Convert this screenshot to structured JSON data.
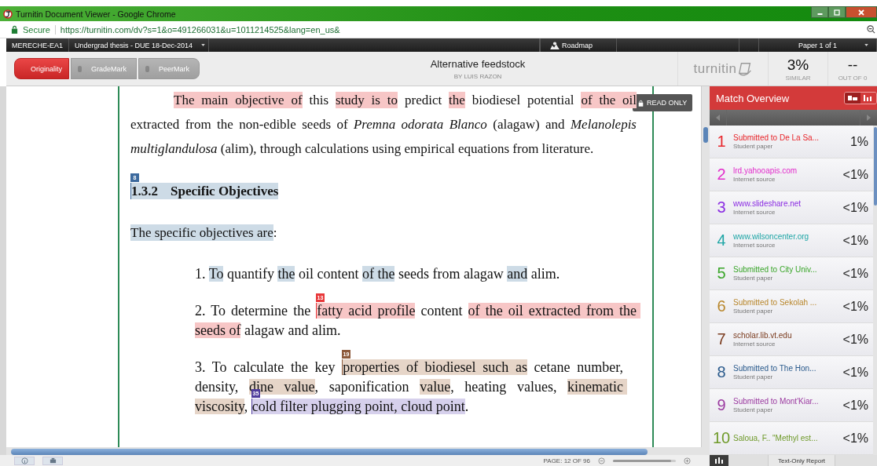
{
  "window": {
    "title": "Turnitin Document Viewer - Google Chrome"
  },
  "address_bar": {
    "secure_label": "Secure",
    "url": "https://turnitin.com/dv?s=1&o=491266031&u=1011214525&lang=en_us&"
  },
  "nav_bar": {
    "class_name": "MERECHE-EA1",
    "assignment": "Undergrad thesis - DUE 18-Dec-2014",
    "roadmap": "Roadmap",
    "paper": "Paper 1 of 1"
  },
  "tabs": [
    {
      "label": "Originality",
      "selected": true
    },
    {
      "label": "GradeMark",
      "selected": false
    },
    {
      "label": "PeerMark",
      "selected": false
    }
  ],
  "document": {
    "title": "Alternative feedstock",
    "author": "BY LUIS RAZON",
    "read_only": "READ ONLY"
  },
  "brand": "turnitin",
  "scores": [
    {
      "value": "3%",
      "label": "SIMILAR"
    },
    {
      "value": "--",
      "label": "OUT OF 0"
    }
  ],
  "blocks": [
    {
      "kind": "paragraph",
      "segments": [
        {
          "t": "The main objective of",
          "color": "#f7c6c6"
        },
        {
          "t": " this "
        },
        {
          "t": "study is to",
          "color": "#f7c6c6"
        },
        {
          "t": " predict "
        },
        {
          "t": "the",
          "color": "#f7c6c6"
        },
        {
          "t": " biodiesel potential "
        },
        {
          "t": "of the oil",
          "color": "#f7c6c6"
        },
        {
          "t": " extracted from the non-edible seeds of "
        },
        {
          "t": "Premna odorata Blanco",
          "italic": true
        },
        {
          "t": " (alagaw) and "
        },
        {
          "t": "Melanolepis multiglandulosa",
          "italic": true
        },
        {
          "t": " (alim), through calculations using empirical equations from literature."
        }
      ]
    },
    {
      "kind": "heading",
      "segments": [
        {
          "t": "1.3.2\tSpecific Objectives",
          "color": "#cddbe6",
          "marker": {
            "label": "8",
            "color": "#3d6a9e"
          }
        }
      ]
    },
    {
      "kind": "paragraph",
      "segments": [
        {
          "t": "The specific objectives are",
          "color": "#cddbe6"
        },
        {
          "t": ":"
        }
      ]
    },
    {
      "kind": "item",
      "segments": [
        {
          "t": "1. "
        },
        {
          "t": "To",
          "color": "#cddbe6"
        },
        {
          "t": " quantify "
        },
        {
          "t": "the",
          "color": "#cddbe6"
        },
        {
          "t": " oil content "
        },
        {
          "t": "of the",
          "color": "#cddbe6"
        },
        {
          "t": " seeds from alagaw "
        },
        {
          "t": "and",
          "color": "#cddbe6"
        },
        {
          "t": " alim."
        }
      ]
    },
    {
      "kind": "item",
      "segments": [
        {
          "t": "2. To determine the "
        },
        {
          "t": "fatty acid profile",
          "color": "#f7c6c6",
          "marker": {
            "label": "13",
            "color": "#e8383a"
          }
        },
        {
          "t": " content "
        },
        {
          "t": "of the oil extracted from the seeds of",
          "color": "#f7c6c6"
        },
        {
          "t": " alagaw and alim."
        }
      ]
    },
    {
      "kind": "item",
      "segments": [
        {
          "t": "3. To calculate the key "
        },
        {
          "t": "properties of biodiesel such as",
          "color": "#e6d5c8",
          "marker": {
            "label": "19",
            "color": "#8d5a3b"
          }
        },
        {
          "t": " cetane number, density, "
        },
        {
          "t": "dine value",
          "color": "#e6d5c8"
        },
        {
          "t": ", saponification "
        },
        {
          "t": "value",
          "color": "#e6d5c8"
        },
        {
          "t": ", heating values, "
        },
        {
          "t": "kinematic viscosity",
          "color": "#e6d5c8"
        },
        {
          "t": ", "
        },
        {
          "t": "cold filter plugging point, cloud point",
          "color": "#d6d0ec",
          "marker": {
            "label": "35",
            "color": "#4f3c9c"
          }
        },
        {
          "t": "."
        }
      ]
    }
  ],
  "match_overview": {
    "title": "Match Overview",
    "matches": [
      {
        "number": "1",
        "source": "Submitted to De La Sa...",
        "type": "Student paper",
        "percent": "1%",
        "color": "#e8262b"
      },
      {
        "number": "2",
        "source": "lrd.yahooapis.com",
        "type": "Internet source",
        "percent": "<1%",
        "color": "#e22ccb"
      },
      {
        "number": "3",
        "source": "www.slideshare.net",
        "type": "Internet source",
        "percent": "<1%",
        "color": "#8a2be2"
      },
      {
        "number": "4",
        "source": "www.wilsoncenter.org",
        "type": "Internet source",
        "percent": "<1%",
        "color": "#1fa6a6"
      },
      {
        "number": "5",
        "source": "Submitted to City Univ...",
        "type": "Student paper",
        "percent": "<1%",
        "color": "#3aa62a"
      },
      {
        "number": "6",
        "source": "Submitted to Sekolah ...",
        "type": "Student paper",
        "percent": "<1%",
        "color": "#b8862b"
      },
      {
        "number": "7",
        "source": "scholar.lib.vt.edu",
        "type": "Internet source",
        "percent": "<1%",
        "color": "#7a3b1e"
      },
      {
        "number": "8",
        "source": "Submitted to The Hon...",
        "type": "Student paper",
        "percent": "<1%",
        "color": "#2a5a8c"
      },
      {
        "number": "9",
        "source": "Submitted to Mont'Kiar...",
        "type": "Student paper",
        "percent": "<1%",
        "color": "#9b3aa0"
      },
      {
        "number": "10",
        "source": "Saloua, F.. \"Methyl est...",
        "percent": "<1%",
        "color": "#6f9a2a"
      }
    ],
    "text_only_report": "Text-Only Report"
  },
  "footer": {
    "page": "PAGE: 12 OF 96",
    "zoom": {
      "level": 0.92
    }
  }
}
